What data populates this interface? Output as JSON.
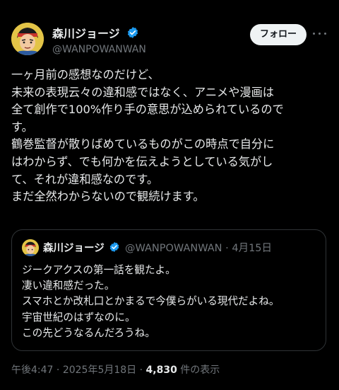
{
  "author": {
    "display_name": "森川ジョージ",
    "handle": "@WANPOWANWAN"
  },
  "follow_button": {
    "label": "フォロー"
  },
  "tweet": {
    "lines": [
      "一ヶ月前の感想なのだけど、",
      "未来の表現云々の違和感ではなく、アニメや漫画は",
      "全て創作で100%作り手の意思が込められているので",
      "す。",
      "鶴巻監督が散りばめているものがこの時点で自分に",
      "はわからず、でも何かを伝えようとしている気がし",
      "て、それが違和感なのです。",
      "まだ全然わからないので観続けます。"
    ]
  },
  "quoted_tweet": {
    "display_name": "森川ジョージ",
    "handle": "@WANPOWANWAN",
    "separator": "·",
    "date": "4月15日",
    "lines": [
      "ジークアクスの第一話を観たよ。",
      "凄い違和感だった。",
      "スマホとか改札口とかまるで今僕らがいる現代だよね。",
      "宇宙世紀のはずなのに。",
      "この先どうなるんだろうね。"
    ]
  },
  "meta": {
    "time": "午後4:47",
    "separator": "·",
    "date": "2025年5月18日",
    "views_count": "4,830",
    "views_label": "件の表示"
  },
  "colors": {
    "background": "#000000",
    "text": "#e7e9ea",
    "secondary": "#71767b",
    "verified": "#1d9bf0",
    "border": "#2f3336"
  },
  "icons": {
    "avatar": "avatar-illustration",
    "verified": "verified-badge-icon",
    "more": "more-dots-icon"
  }
}
